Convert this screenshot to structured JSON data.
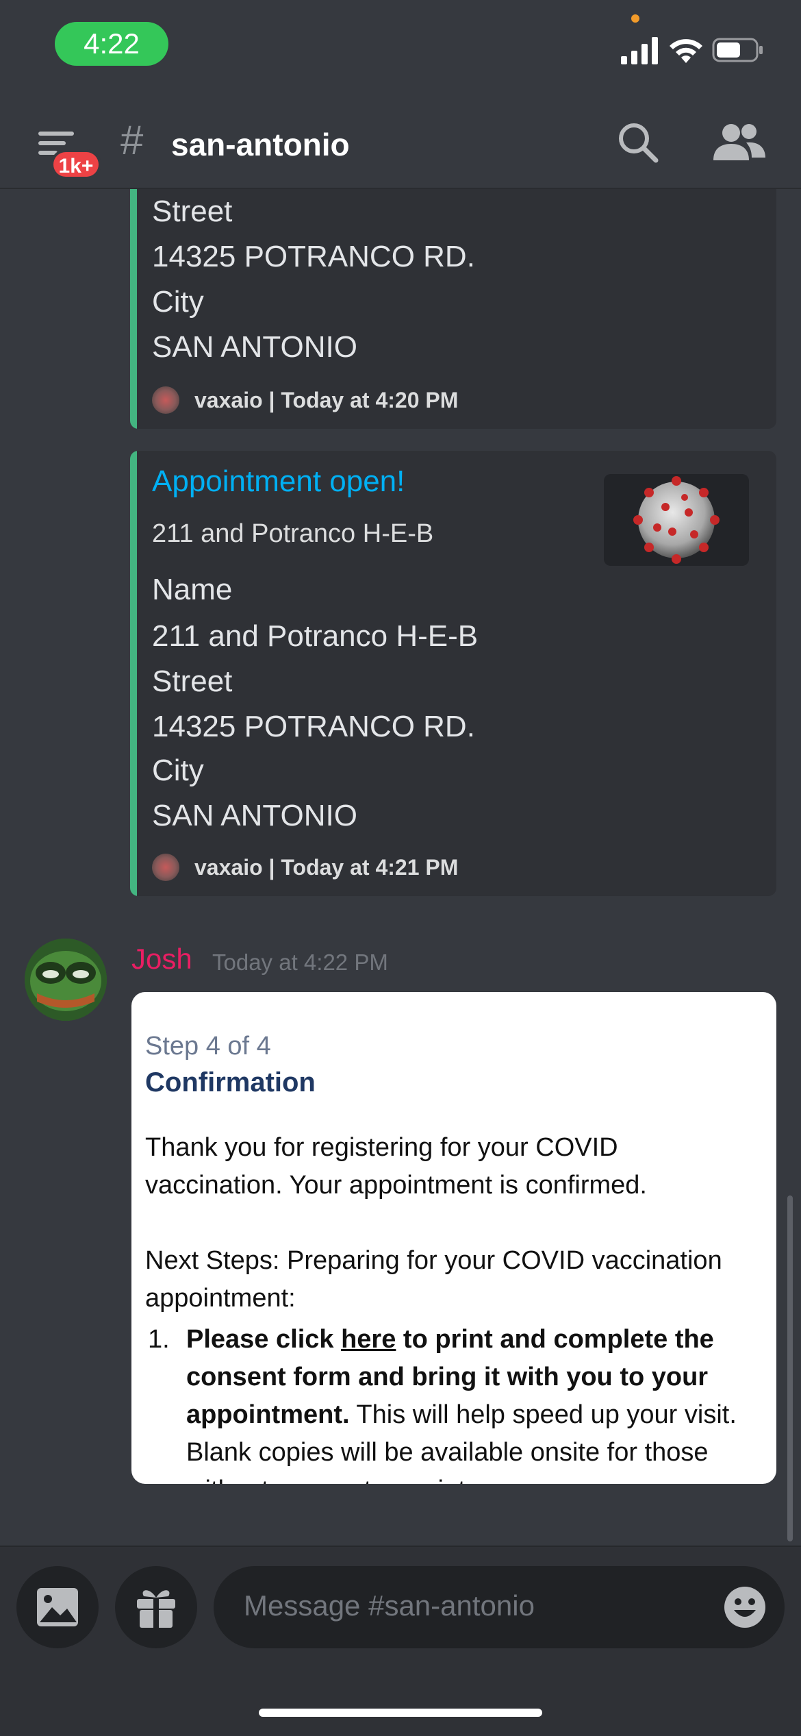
{
  "status_bar": {
    "time": "4:22"
  },
  "header": {
    "badge": "1k+",
    "hash": "#",
    "channel": "san-antonio"
  },
  "embed_top": {
    "lines": [
      "Street",
      "14325 POTRANCO RD.",
      "City",
      "SAN ANTONIO"
    ],
    "footer": "vaxaio | Today at 4:20 PM"
  },
  "embed_main": {
    "title": "Appointment open!",
    "subtitle": "211 and Potranco H-E-B",
    "lines": [
      "Name",
      "211 and Potranco H-E-B",
      "Street",
      "14325 POTRANCO RD.",
      "City",
      "SAN ANTONIO"
    ],
    "footer": "vaxaio | Today at 4:21 PM"
  },
  "message": {
    "author": "Josh",
    "timestamp": "Today at 4:22 PM",
    "screenshot": {
      "step": "Step 4 of 4",
      "heading": "Confirmation",
      "para1": "Thank you for registering for your COVID vaccination. Your appointment is confirmed.",
      "para2": "Next Steps: Preparing for your COVID vaccination appointment:",
      "item_num": "1.",
      "item_bold_1": "Please click ",
      "item_link": "here",
      "item_bold_2": " to print and complete the consent form and bring it with you to your appointment.",
      "item_rest": " This will help speed up your visit. Blank copies will be available onsite for those without access to a printer."
    }
  },
  "composer": {
    "placeholder": "Message #san-antonio"
  },
  "colors": {
    "bg": "#36393f",
    "embed_bar": "#43b581",
    "link": "#00b0f4",
    "author": "#e91e63"
  }
}
